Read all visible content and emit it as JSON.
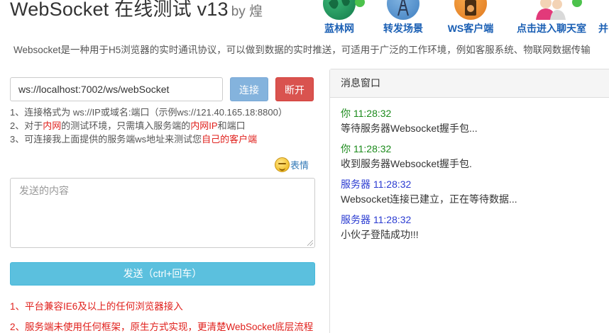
{
  "header": {
    "title": "WebSocket 在线测试 v13",
    "by": "by 煌"
  },
  "nav": [
    {
      "label": "蓝林网",
      "icon": "globe-icon"
    },
    {
      "label": "转发场景",
      "icon": "tower-icon"
    },
    {
      "label": "WS客户端",
      "icon": "speaker-icon"
    },
    {
      "label": "点击进入聊天室",
      "icon": "users-icon"
    },
    {
      "label": "并",
      "icon": ""
    }
  ],
  "description": "Websocket是一种用于H5浏览器的实时通讯协议，可以做到数据的实时推送，可适用于广泛的工作环境，例如客服系统、物联网数据传输",
  "connection": {
    "url": "ws://localhost:7002/ws/webSocket",
    "connect_label": "连接",
    "disconnect_label": "断开"
  },
  "tips": {
    "line1": "1、连接格式为 ws://IP或域名:端口（示例ws://121.40.165.18:8800）",
    "line2_a": "2、对于",
    "line2_b": "内网",
    "line2_c": "的测试环境，只需填入服务端的",
    "line2_d": "内网IP",
    "line2_e": "和端口",
    "line3_a": "3、可连接我上面提供的服务端ws地址来测试您",
    "line3_b": "自己的客户端"
  },
  "emoji_label": "表情",
  "message_input": {
    "placeholder": "发送的内容"
  },
  "send_label": "发送（ctrl+回车）",
  "notes": [
    "1、平台兼容IE6及以上的任何浏览器接入",
    "2、服务端未使用任何框架，原生方式实现，更清楚WebSocket底层流程"
  ],
  "message_window": {
    "title": "消息窗口",
    "messages": [
      {
        "sender": "你 11:28:32",
        "text": "等待服务器Websocket握手包..."
      },
      {
        "sender": "你 11:28:32",
        "text": "收到服务器Websocket握手包."
      },
      {
        "sender": "服务器 11:28:32",
        "text": "Websocket连接已建立，正在等待数据..."
      },
      {
        "sender": "服务器 11:28:32",
        "text": "小伙子登陆成功!!!"
      }
    ]
  },
  "colors": {
    "you": "#1b8a1b",
    "server": "#2a3bd1",
    "connect_button": "#84b3dd",
    "disconnect_button": "#d9534f",
    "send_button": "#5bc0de",
    "nav_label": "#1a5fb4",
    "highlight_red": "#e0201c"
  }
}
